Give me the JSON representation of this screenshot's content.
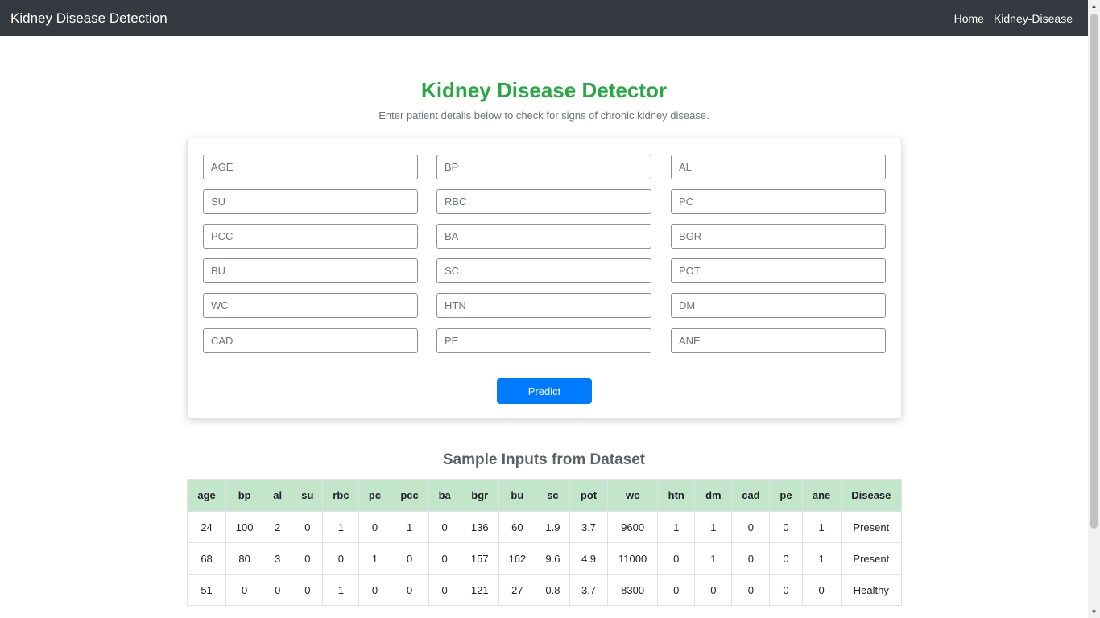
{
  "nav": {
    "brand": "Kidney Disease Detection",
    "links": [
      "Home",
      "Kidney-Disease"
    ]
  },
  "header": {
    "title": "Kidney Disease Detector",
    "subtitle": "Enter patient details below to check for signs of chronic kidney disease."
  },
  "form": {
    "fields": [
      "AGE",
      "BP",
      "AL",
      "SU",
      "RBC",
      "PC",
      "PCC",
      "BA",
      "BGR",
      "BU",
      "SC",
      "POT",
      "WC",
      "HTN",
      "DM",
      "CAD",
      "PE",
      "ANE"
    ],
    "submit_label": "Predict"
  },
  "samples": {
    "title": "Sample Inputs from Dataset",
    "columns": [
      "age",
      "bp",
      "al",
      "su",
      "rbc",
      "pc",
      "pcc",
      "ba",
      "bgr",
      "bu",
      "sc",
      "pot",
      "wc",
      "htn",
      "dm",
      "cad",
      "pe",
      "ane",
      "Disease"
    ],
    "rows": [
      [
        "24",
        "100",
        "2",
        "0",
        "1",
        "0",
        "1",
        "0",
        "136",
        "60",
        "1.9",
        "3.7",
        "9600",
        "1",
        "1",
        "0",
        "0",
        "1",
        "Present"
      ],
      [
        "68",
        "80",
        "3",
        "0",
        "0",
        "1",
        "0",
        "0",
        "157",
        "162",
        "9.6",
        "4.9",
        "11000",
        "0",
        "1",
        "0",
        "0",
        "1",
        "Present"
      ],
      [
        "51",
        "0",
        "0",
        "0",
        "1",
        "0",
        "0",
        "0",
        "121",
        "27",
        "0.8",
        "3.7",
        "8300",
        "0",
        "0",
        "0",
        "0",
        "0",
        "Healthy"
      ]
    ]
  },
  "colors": {
    "navbar": "#343a40",
    "title": "#28a745",
    "button": "#007bff",
    "table_header": "#c3e6cb"
  }
}
